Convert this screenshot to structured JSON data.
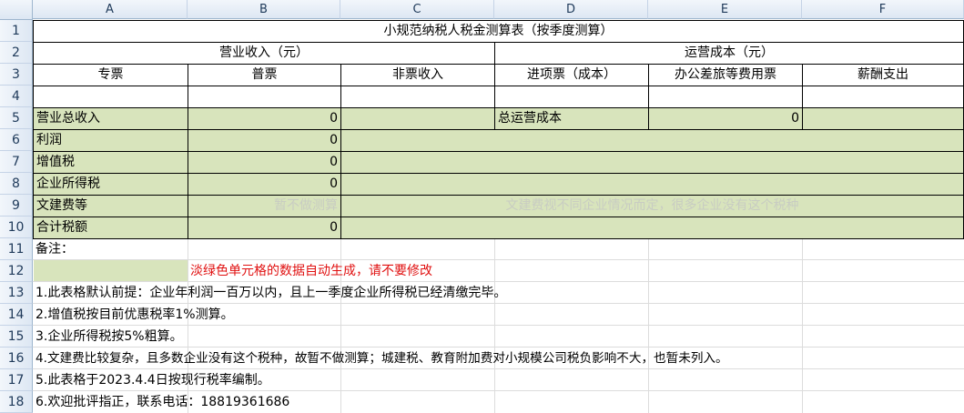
{
  "columns": [
    "A",
    "B",
    "C",
    "D",
    "E",
    "F"
  ],
  "rows": [
    "1",
    "2",
    "3",
    "4",
    "5",
    "6",
    "7",
    "8",
    "9",
    "10",
    "11",
    "12",
    "13",
    "14",
    "15",
    "16",
    "17",
    "18"
  ],
  "title": "小规范纳税人税金测算表（按季度测算）",
  "revenue_header": "营业收入（元）",
  "cost_header": "运营成本（元）",
  "sub_headers": {
    "zhuanpiao": "专票",
    "pupiao": "普票",
    "feipiao": "非票收入",
    "jinxiang": "进项票（成本）",
    "bangong": "办公差旅等费用票",
    "xinchou": "薪酬支出"
  },
  "summary": {
    "total_revenue_label": "营业总收入",
    "total_revenue_value": "0",
    "total_cost_label": "总运营成本",
    "total_cost_value": "0",
    "profit_label": "利润",
    "profit_value": "0",
    "vat_label": "增值税",
    "vat_value": "0",
    "income_tax_label": "企业所得税",
    "income_tax_value": "0",
    "culture_fee_label": "文建费等",
    "culture_fee_value": "暂不做测算",
    "culture_fee_note": "文建费视不同企业情况而定，很多企业没有这个税种",
    "total_tax_label": "合计税额",
    "total_tax_value": "0"
  },
  "notes": {
    "label": "备注：",
    "legend": "淡绿色单元格的数据自动生成，请不要修改",
    "n1": "1.此表格默认前提：企业年利润一百万以内，且上一季度企业所得税已经清缴完毕。",
    "n2": "2.增值税按目前优惠税率1%测算。",
    "n3": "3.企业所得税按5%粗算。",
    "n4": "4.文建费比较复杂，且多数企业没有这个税种，故暂不做测算；城建税、教育附加费对小规模公司税负影响不大，也暂未列入。",
    "n5": "5.此表格于2023.4.4日按现行税率编制。",
    "n6": "6.欢迎批评指正，联系电话：18819361686"
  },
  "colors": {
    "green_fill": "#d8e4bc",
    "warning_text": "#e01010"
  }
}
